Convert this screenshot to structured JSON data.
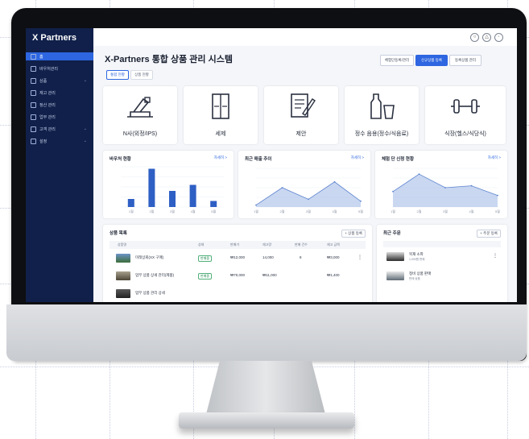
{
  "app": {
    "logo": "X Partners",
    "title": "X-Partners 통합 상품 관리 시스템"
  },
  "sidebar": {
    "items": [
      {
        "label": "홈",
        "active": true
      },
      {
        "label": "바우처관리",
        "active": false
      },
      {
        "label": "상품",
        "active": false
      },
      {
        "label": "재고 관리",
        "active": false
      },
      {
        "label": "정산 관리",
        "active": false
      },
      {
        "label": "업무 관리",
        "active": false
      },
      {
        "label": "고객 관리",
        "active": false
      },
      {
        "label": "설정",
        "active": false
      }
    ]
  },
  "header": {
    "buttons": [
      "체험단등록/관리",
      "신규상품 등록",
      "등록상품 관리"
    ],
    "tabs": [
      "통합 현황",
      "상품 현황"
    ]
  },
  "categories": [
    {
      "label": "N사(외정/IPS)",
      "icon": "appliance-icon"
    },
    {
      "label": "세제",
      "icon": "cabinet-icon"
    },
    {
      "label": "제안",
      "icon": "document-edit-icon"
    },
    {
      "label": "정수 음용(정수/식음료)",
      "icon": "bottle-cup-icon"
    },
    {
      "label": "식장(헬스/식당식)",
      "icon": "dumbbell-icon"
    }
  ],
  "charts": {
    "bar": {
      "title": "바우처 현황",
      "link": "자세히 >",
      "chart_data": {
        "type": "bar",
        "categories": [
          "1월",
          "2월",
          "3월",
          "4월",
          "5월"
        ],
        "values": [
          20,
          95,
          40,
          55,
          15
        ],
        "ylim": [
          0,
          100
        ]
      }
    },
    "area1": {
      "title": "최근 매출 추이",
      "link": "자세히 >",
      "chart_data": {
        "type": "area",
        "x": [
          "1월",
          "2월",
          "3월",
          "4월",
          "5월"
        ],
        "values": [
          5,
          50,
          20,
          65,
          15
        ],
        "ylim": [
          0,
          100
        ]
      }
    },
    "area2": {
      "title": "체험 단 신청 현황",
      "link": "자세히 >",
      "chart_data": {
        "type": "area",
        "x": [
          "1월",
          "2월",
          "3월",
          "4월",
          "5월"
        ],
        "values": [
          40,
          85,
          50,
          55,
          30
        ],
        "ylim": [
          0,
          100
        ]
      }
    }
  },
  "products": {
    "title": "상품 목록",
    "link": "+ 상품 등록",
    "columns": [
      "상품명",
      "상태",
      "판매가",
      "재고량",
      "판매 건수",
      "재고 금액"
    ],
    "rows": [
      {
        "name": "미래상회(XX 구매)",
        "status": "판매중",
        "price": "₩12,000",
        "stock": "14,000",
        "count": "8",
        "amount": "₩3,000"
      },
      {
        "name": "업무 상품 상세 관리(제품)",
        "status": "판매중",
        "price": "₩70,000",
        "stock": "₩11,000",
        "count": "",
        "amount": "₩1,400"
      },
      {
        "name": "업무 상품 관리 상세",
        "status": "",
        "price": "",
        "stock": "",
        "count": "",
        "amount": ""
      }
    ]
  },
  "orders": {
    "title": "최근 주문",
    "link": "+ 주문 등록",
    "rows": [
      {
        "name": "목재 소파",
        "sub": "1,000원 판매"
      },
      {
        "name": "정비 상품 판매",
        "sub": "판매 상품"
      }
    ]
  },
  "colors": {
    "sidebar": "#10204a",
    "accent": "#2d66e0",
    "bar": "#2e5fc4",
    "area": "#9db6e6"
  }
}
